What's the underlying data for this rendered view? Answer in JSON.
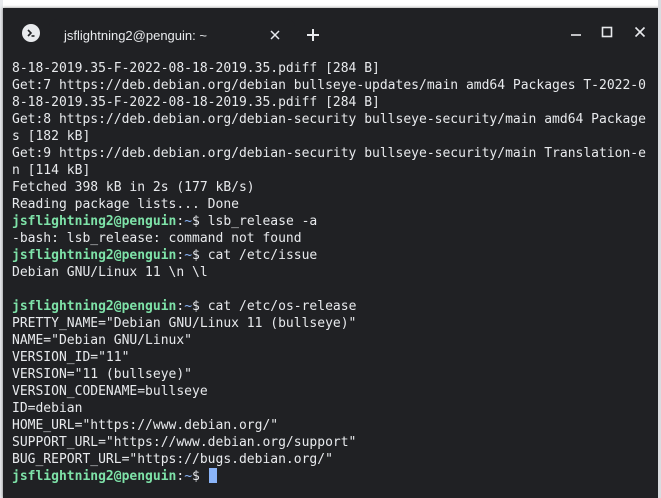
{
  "window": {
    "tab_title": "jsflightning2@penguin: ~",
    "new_tab_label": "+",
    "colors": {
      "background": "#202124",
      "prompt_user": "#7ee2a8",
      "prompt_path": "#8ab4f8",
      "text": "#e8eaed"
    },
    "icons": [
      "terminal-app-icon",
      "close-icon",
      "plus-icon",
      "minimize-icon",
      "maximize-icon",
      "window-close-icon"
    ]
  },
  "terminal": {
    "lines": [
      {
        "type": "out",
        "text": "8-18-2019.35-F-2022-08-18-2019.35.pdiff [284 B]"
      },
      {
        "type": "out",
        "text": "Get:7 https://deb.debian.org/debian bullseye-updates/main amd64 Packages T-2022-0"
      },
      {
        "type": "out",
        "text": "8-18-2019.35-F-2022-08-18-2019.35.pdiff [284 B]"
      },
      {
        "type": "out",
        "text": "Get:8 https://deb.debian.org/debian-security bullseye-security/main amd64 Package"
      },
      {
        "type": "out",
        "text": "s [182 kB]"
      },
      {
        "type": "out",
        "text": "Get:9 https://deb.debian.org/debian-security bullseye-security/main Translation-e"
      },
      {
        "type": "out",
        "text": "n [114 kB]"
      },
      {
        "type": "out",
        "text": "Fetched 398 kB in 2s (177 kB/s)"
      },
      {
        "type": "out",
        "text": "Reading package lists... Done"
      },
      {
        "type": "cmd",
        "user": "jsflightning2@penguin",
        "sep": ":",
        "path": "~",
        "sym": "$ ",
        "cmd": "lsb_release -a"
      },
      {
        "type": "out",
        "text": "-bash: lsb_release: command not found"
      },
      {
        "type": "cmd",
        "user": "jsflightning2@penguin",
        "sep": ":",
        "path": "~",
        "sym": "$ ",
        "cmd": "cat /etc/issue"
      },
      {
        "type": "out",
        "text": "Debian GNU/Linux 11 \\n \\l"
      },
      {
        "type": "out",
        "text": ""
      },
      {
        "type": "cmd",
        "user": "jsflightning2@penguin",
        "sep": ":",
        "path": "~",
        "sym": "$ ",
        "cmd": "cat /etc/os-release"
      },
      {
        "type": "out",
        "text": "PRETTY_NAME=\"Debian GNU/Linux 11 (bullseye)\""
      },
      {
        "type": "out",
        "text": "NAME=\"Debian GNU/Linux\""
      },
      {
        "type": "out",
        "text": "VERSION_ID=\"11\""
      },
      {
        "type": "out",
        "text": "VERSION=\"11 (bullseye)\""
      },
      {
        "type": "out",
        "text": "VERSION_CODENAME=bullseye"
      },
      {
        "type": "out",
        "text": "ID=debian"
      },
      {
        "type": "out",
        "text": "HOME_URL=\"https://www.debian.org/\""
      },
      {
        "type": "out",
        "text": "SUPPORT_URL=\"https://www.debian.org/support\""
      },
      {
        "type": "out",
        "text": "BUG_REPORT_URL=\"https://bugs.debian.org/\""
      },
      {
        "type": "cmd",
        "user": "jsflightning2@penguin",
        "sep": ":",
        "path": "~",
        "sym": "$ ",
        "cmd": "",
        "cursor": true
      }
    ]
  }
}
